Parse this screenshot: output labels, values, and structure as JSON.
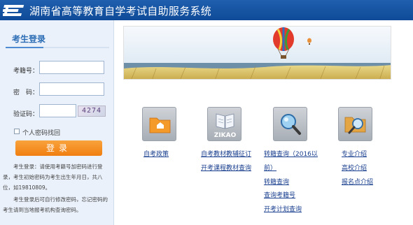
{
  "header": {
    "title": "湖南省高等教育自学考试自助服务系统",
    "logo_icon": "e-logo-icon"
  },
  "login": {
    "title": "考生登录",
    "exam_no_label": "考籍号：",
    "password_label": "密　码：",
    "captcha_label": "验证码：",
    "exam_no_value": "",
    "password_value": "",
    "captcha_value": "",
    "captcha_text": "4274",
    "forgot_label": "个人密码找回",
    "submit_label": "登录",
    "note1": "考生登录：请使用考籍号加密码进行登录，考生初始密码为考生出生年月日，共八位，如19810809。",
    "note2": "考生登录后可自行修改密码，忘记密码的考生请到当地报考机构查询密码。"
  },
  "icons": {
    "col1": "folder-home-icon",
    "col2": "zikao-book-icon",
    "col3": "magnifier-icon",
    "col4": "folder-search-icon",
    "zikao_text": "ZIKAO"
  },
  "links": {
    "col1": [
      "自考政策"
    ],
    "col2": [
      "自考教材教辅征订",
      "开考课程教材查询"
    ],
    "col3": [
      "转籍查询（2016以",
      "前）",
      "转籍查询",
      "查询考籍号",
      "开考计划查询"
    ],
    "col4": [
      "专业介绍",
      "高校介绍",
      "报名点介绍"
    ]
  },
  "colors": {
    "header": "#1453a3",
    "accent": "#f58a1f",
    "link": "#1a3f8f"
  }
}
